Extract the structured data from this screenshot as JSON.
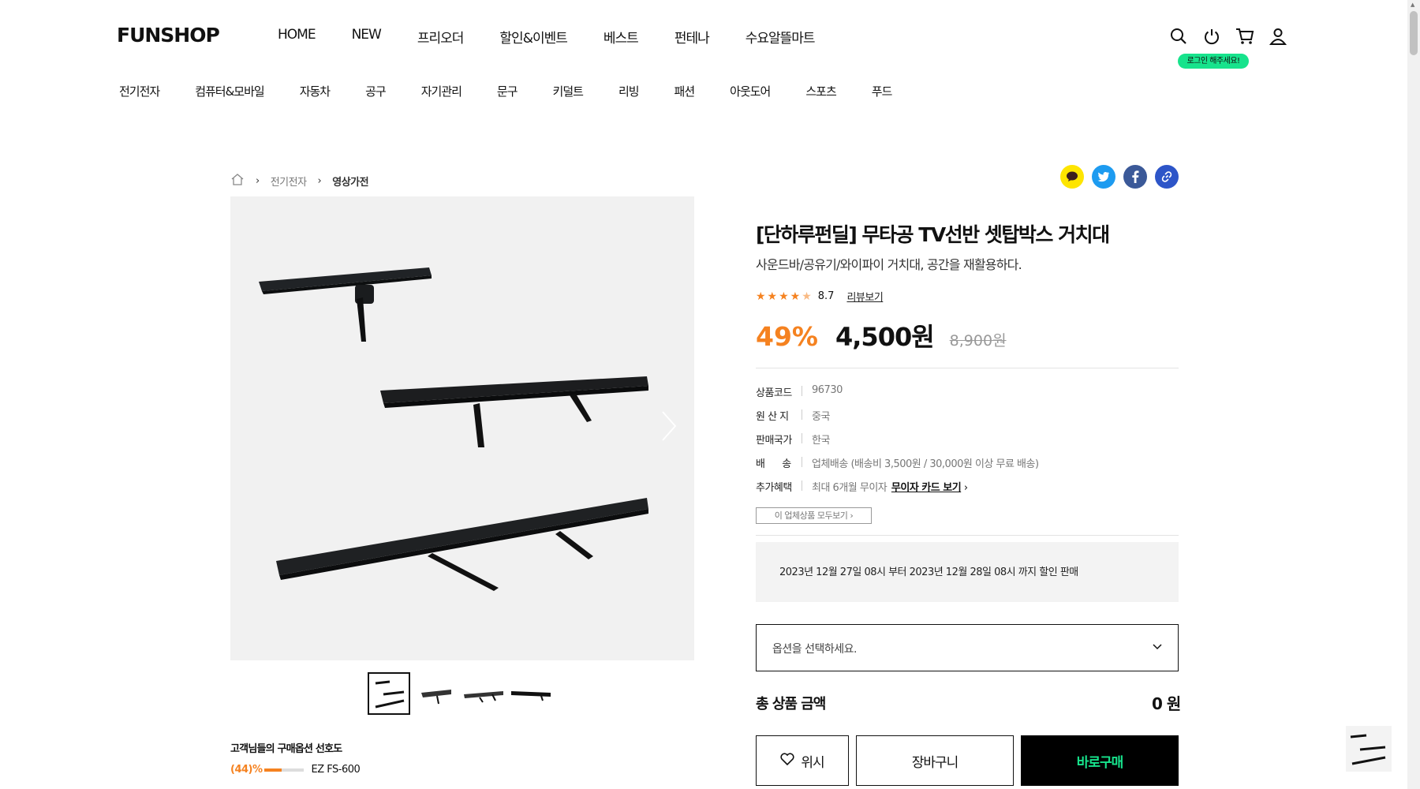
{
  "header": {
    "logo": "FUNSHOP",
    "gnb": [
      "HOME",
      "NEW",
      "프리오더",
      "할인&이벤트",
      "베스트",
      "펀테나",
      "수요알뜰마트"
    ],
    "login_tooltip": "로그인 해주세요!",
    "categories": [
      "전기전자",
      "컴퓨터&모바일",
      "자동차",
      "공구",
      "자기관리",
      "문구",
      "키덜트",
      "리빙",
      "패션",
      "아웃도어",
      "스포츠",
      "푸드"
    ]
  },
  "breadcrumb": {
    "level1": "전기전자",
    "level2": "영상가전"
  },
  "product": {
    "title": "[단하루펀딜] 무타공 TV선반 셋탑박스 거치대",
    "subtitle": "사운드바/공유기/와이파이 거치대, 공간을 재활용하다.",
    "rating": "8.7",
    "review_link": "리뷰보기",
    "discount": "49%",
    "price": "4,500원",
    "original_price": "8,900원",
    "specs": [
      {
        "key": "상품코드",
        "value": "96730"
      },
      {
        "key": "원 산 지",
        "value": "중국"
      },
      {
        "key": "판매국가",
        "value": "한국"
      },
      {
        "key": "배      송",
        "value": "업체배송 (배송비 3,500원 / 30,000원 이상 무료 배송)"
      },
      {
        "key": "추가혜택",
        "value": "최대 6개월 무이자",
        "link": "무이자 카드 보기"
      }
    ],
    "brand_button": "이 업체상품 모두보기",
    "sale_period": "2023년 12월 27일 08시 부터 2023년 12월 28일 08시 까지 할인 판매",
    "option_placeholder": "옵션을 선택하세요.",
    "total_label": "총 상품 금액",
    "total_value": "0 원",
    "wish_label": "위시",
    "cart_label": "장바구니",
    "buy_label": "바로구매"
  },
  "preference": {
    "title": "고객님들의 구매옵션 선호도",
    "percent_label": "(44)%",
    "percent": 44,
    "option": "EZ FS-600"
  },
  "colors": {
    "accent": "#f58220",
    "buy_text": "#17e38c",
    "login_badge": "#17e38c"
  }
}
